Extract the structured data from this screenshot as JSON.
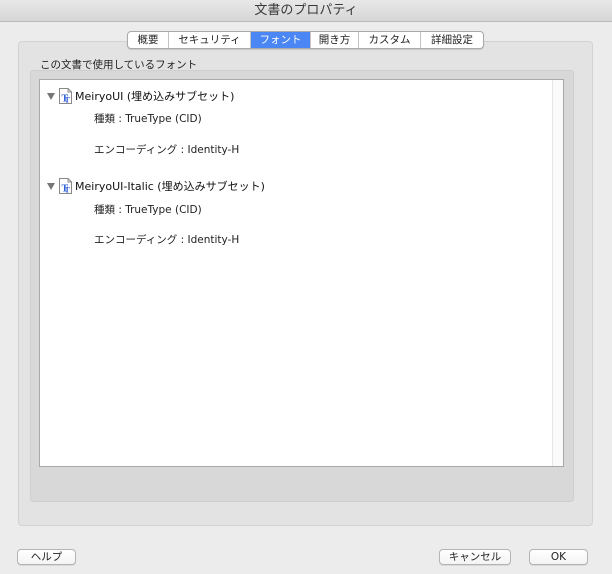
{
  "window": {
    "title": "文書のプロパティ"
  },
  "tabs": [
    {
      "label": "概要",
      "active": false
    },
    {
      "label": "セキュリティ",
      "active": false
    },
    {
      "label": "フォント",
      "active": true
    },
    {
      "label": "開き方",
      "active": false
    },
    {
      "label": "カスタム",
      "active": false
    },
    {
      "label": "詳細設定",
      "active": false
    }
  ],
  "fonts_section": {
    "label": "この文書で使用しているフォント",
    "fonts": [
      {
        "name": "MeiryoUI (埋め込みサブセット)",
        "type": "種類 : TrueType (CID)",
        "encoding": "エンコーディング : Identity-H"
      },
      {
        "name": "MeiryoUI-Italic (埋め込みサブセット)",
        "type": "種類 : TrueType (CID)",
        "encoding": "エンコーディング : Identity-H"
      }
    ]
  },
  "buttons": {
    "help": "ヘルプ",
    "cancel": "キャンセル",
    "ok": "OK"
  },
  "colors": {
    "active_tab": "#4a86f4",
    "font_icon": "#2a5bd7"
  }
}
